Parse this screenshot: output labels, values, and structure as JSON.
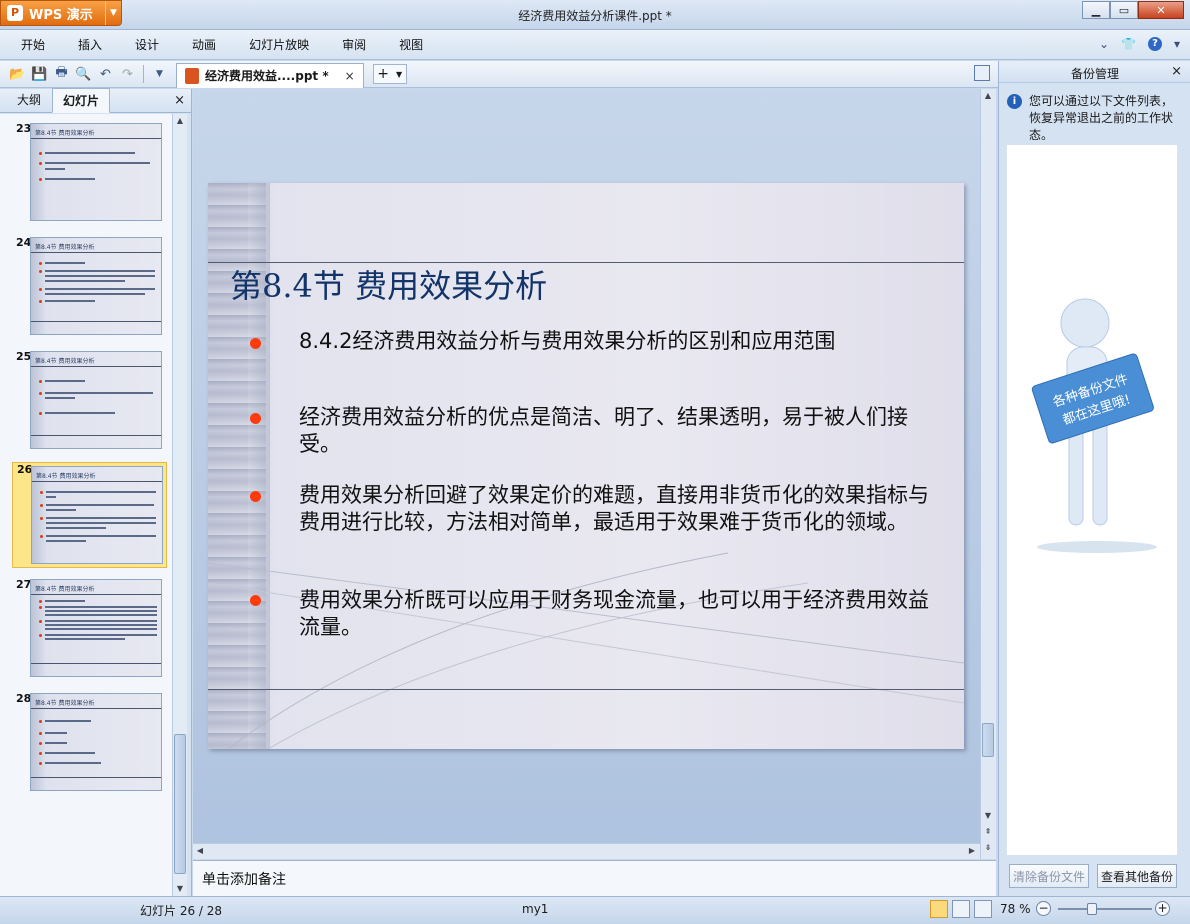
{
  "app": {
    "name": "WPS 演示",
    "window_title": "经济费用效益分析课件.ppt *"
  },
  "menu": {
    "items": [
      "开始",
      "插入",
      "设计",
      "动画",
      "幻灯片放映",
      "审阅",
      "视图"
    ]
  },
  "toolbar": {
    "icons": [
      "open-folder-icon",
      "save-icon",
      "print-icon",
      "print-preview-icon",
      "undo-icon",
      "redo-icon",
      "dropdown-icon"
    ]
  },
  "doc_tab": {
    "label": "经济费用效益....ppt *",
    "close": "×",
    "new_tab": "+"
  },
  "left_panel": {
    "tabs": [
      "大纲",
      "幻灯片"
    ],
    "active_tab": "幻灯片",
    "close": "×",
    "thumbnails": [
      {
        "num": "23",
        "title": "第8.4节 费用效果分析",
        "selected": false
      },
      {
        "num": "24",
        "title": "第8.4节 费用效果分析",
        "selected": false
      },
      {
        "num": "25",
        "title": "第8.4节 费用效果分析",
        "selected": false
      },
      {
        "num": "26",
        "title": "第8.4节 费用效果分析",
        "selected": true
      },
      {
        "num": "27",
        "title": "第8.4节 费用效果分析",
        "selected": false
      },
      {
        "num": "28",
        "title": "第8.4节 费用效果分析",
        "selected": false
      }
    ]
  },
  "slide": {
    "title": "第8.4节   费用效果分析",
    "bullets": [
      "8.4.2经济费用效益分析与费用效果分析的区别和应用范围",
      "经济费用效益分析的优点是简洁、明了、结果透明，易于被人们接受。",
      "费用效果分析回避了效果定价的难题，直接用非货币化的效果指标与费用进行比较，方法相对简单，最适用于效果难于货币化的领域。",
      "费用效果分析既可以应用于财务现金流量，也可以用于经济费用效益流量。"
    ],
    "bullet_color": "#ff3b0e",
    "title_color": "#123468"
  },
  "notes": {
    "placeholder": "单击添加备注"
  },
  "right_panel": {
    "title": "备份管理",
    "close": "×",
    "info": "您可以通过以下文件列表，恢复异常退出之前的工作状态。",
    "illustration_text": "各种备份文件都在这里哦!",
    "buttons": {
      "clear": "清除备份文件",
      "view_other": "查看其他备份"
    }
  },
  "statusbar": {
    "slide_counter": "幻灯片 26 / 28",
    "theme": "my1",
    "zoom": "78 %",
    "zoom_level": 0.78
  },
  "colors": {
    "accent_orange": "#e06d0f",
    "selection_yellow": "#fde58a"
  }
}
